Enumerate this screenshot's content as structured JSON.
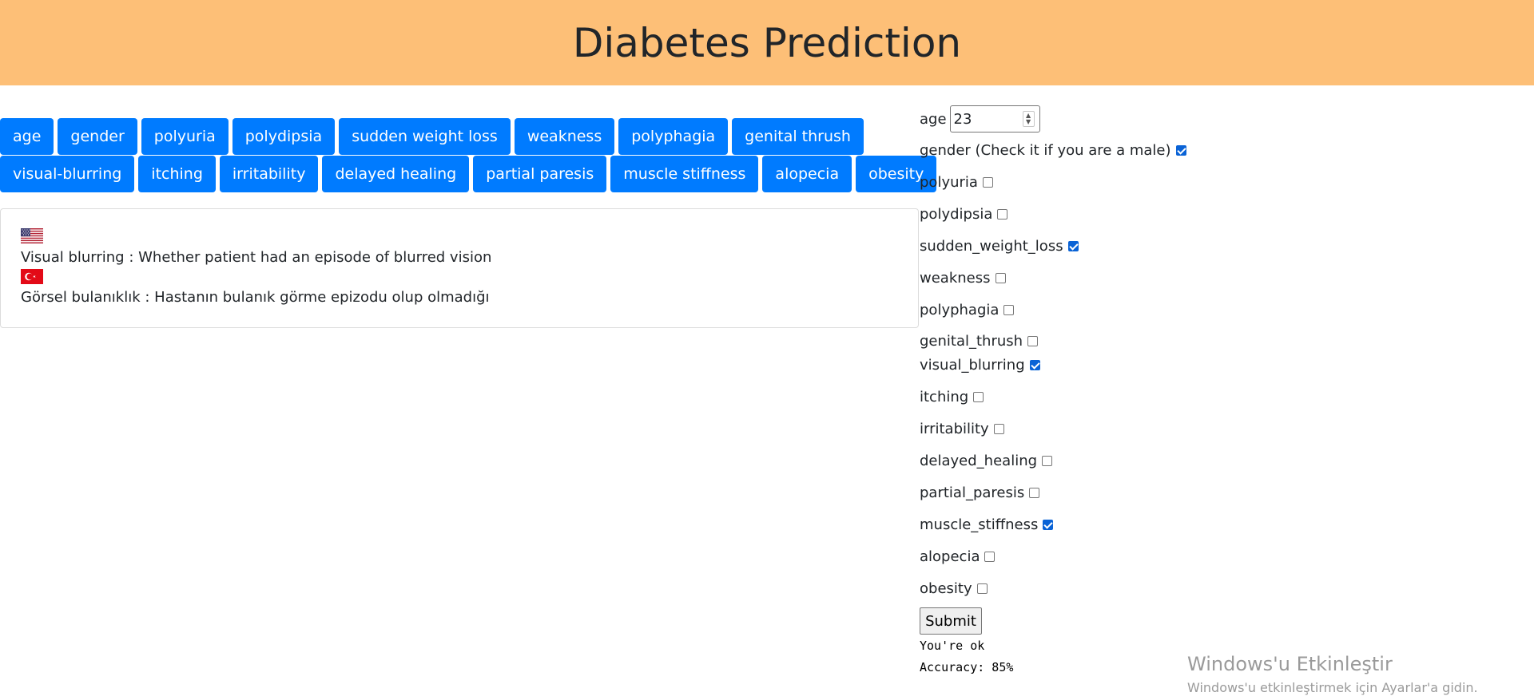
{
  "header": {
    "title": "Diabetes Prediction"
  },
  "feature_buttons": {
    "row1": [
      "age",
      "gender",
      "polyuria",
      "polydipsia",
      "sudden weight loss",
      "weakness",
      "polyphagia",
      "genital thrush"
    ],
    "row2": [
      "visual-blurring",
      "itching",
      "irritability",
      "delayed healing",
      "partial paresis",
      "muscle stiffness",
      "alopecia",
      "obesity"
    ]
  },
  "description": {
    "en_flag_icon": "us-flag-icon",
    "en_text": "Visual blurring : Whether patient had an episode of blurred vision",
    "tr_flag_icon": "turkey-flag-icon",
    "tr_text": "Görsel bulanıklık : Hastanın bulanık görme epizodu olup olmadığı"
  },
  "form": {
    "age_label": "age",
    "age_value": "23",
    "fields": [
      {
        "label": "gender (Check it if you are a male)",
        "checked": true
      },
      {
        "label": "polyuria",
        "checked": false
      },
      {
        "label": "polydipsia",
        "checked": false
      },
      {
        "label": "sudden_weight_loss",
        "checked": true
      },
      {
        "label": "weakness",
        "checked": false
      },
      {
        "label": "polyphagia",
        "checked": false
      },
      {
        "label": "genital_thrush",
        "checked": false
      },
      {
        "label": "visual_blurring",
        "checked": true
      },
      {
        "label": "itching",
        "checked": false
      },
      {
        "label": "irritability",
        "checked": false
      },
      {
        "label": "delayed_healing",
        "checked": false
      },
      {
        "label": "partial_paresis",
        "checked": false
      },
      {
        "label": "muscle_stiffness",
        "checked": true
      },
      {
        "label": "alopecia",
        "checked": false
      },
      {
        "label": "obesity",
        "checked": false
      }
    ],
    "submit_label": "Submit"
  },
  "result": {
    "status": "You're ok",
    "accuracy": "Accuracy: 85%"
  },
  "watermark": {
    "title": "Windows'u Etkinleştir",
    "subtitle": "Windows'u etkinleştirmek için Ayarlar'a gidin."
  },
  "colors": {
    "header_bg": "#fdbf77",
    "button_bg": "#007bff",
    "checkbox_checked": "#0a63d6"
  }
}
